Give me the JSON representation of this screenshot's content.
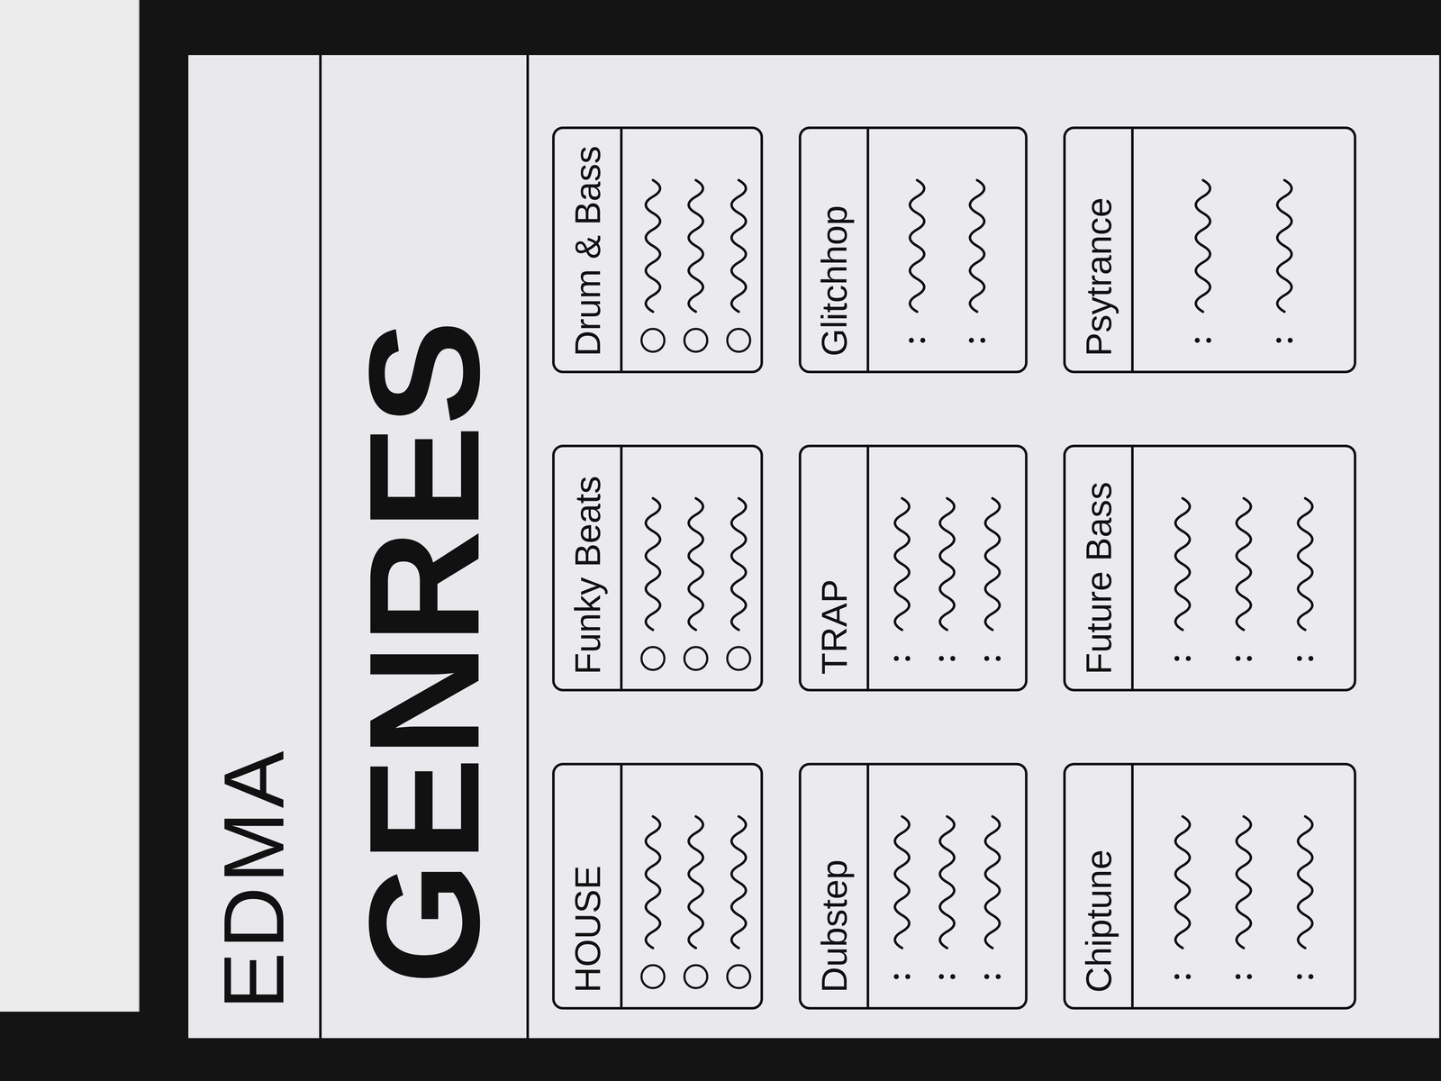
{
  "paper": {
    "logo": "EDMA",
    "title": "GENRES"
  },
  "cards": [
    {
      "title": "HOUSE",
      "rows": [
        {
          "kind": "circle"
        },
        {
          "kind": "circle"
        },
        {
          "kind": "circle"
        }
      ]
    },
    {
      "title": "Funky Beats",
      "rows": [
        {
          "kind": "circle"
        },
        {
          "kind": "circle"
        },
        {
          "kind": "circle"
        }
      ]
    },
    {
      "title": "Drum & Bass",
      "rows": [
        {
          "kind": "circle"
        },
        {
          "kind": "circle"
        },
        {
          "kind": "circle"
        }
      ]
    },
    {
      "title": "Dubstep",
      "rows": [
        {
          "kind": "dots"
        },
        {
          "kind": "dots"
        },
        {
          "kind": "dots"
        }
      ]
    },
    {
      "title": "TRAP",
      "rows": [
        {
          "kind": "dots"
        },
        {
          "kind": "dots"
        },
        {
          "kind": "dots"
        }
      ]
    },
    {
      "title": "Glitchhop",
      "rows": [
        {
          "kind": "dots"
        },
        {
          "kind": "dots"
        }
      ]
    },
    {
      "title": "Chiptune",
      "rows": [
        {
          "kind": "dots"
        },
        {
          "kind": "dots"
        },
        {
          "kind": "dots"
        }
      ]
    },
    {
      "title": "Future Bass",
      "rows": [
        {
          "kind": "dots"
        },
        {
          "kind": "dots"
        },
        {
          "kind": "dots"
        }
      ]
    },
    {
      "title": "Psytrance",
      "rows": [
        {
          "kind": "dots"
        },
        {
          "kind": "dots"
        }
      ]
    }
  ]
}
